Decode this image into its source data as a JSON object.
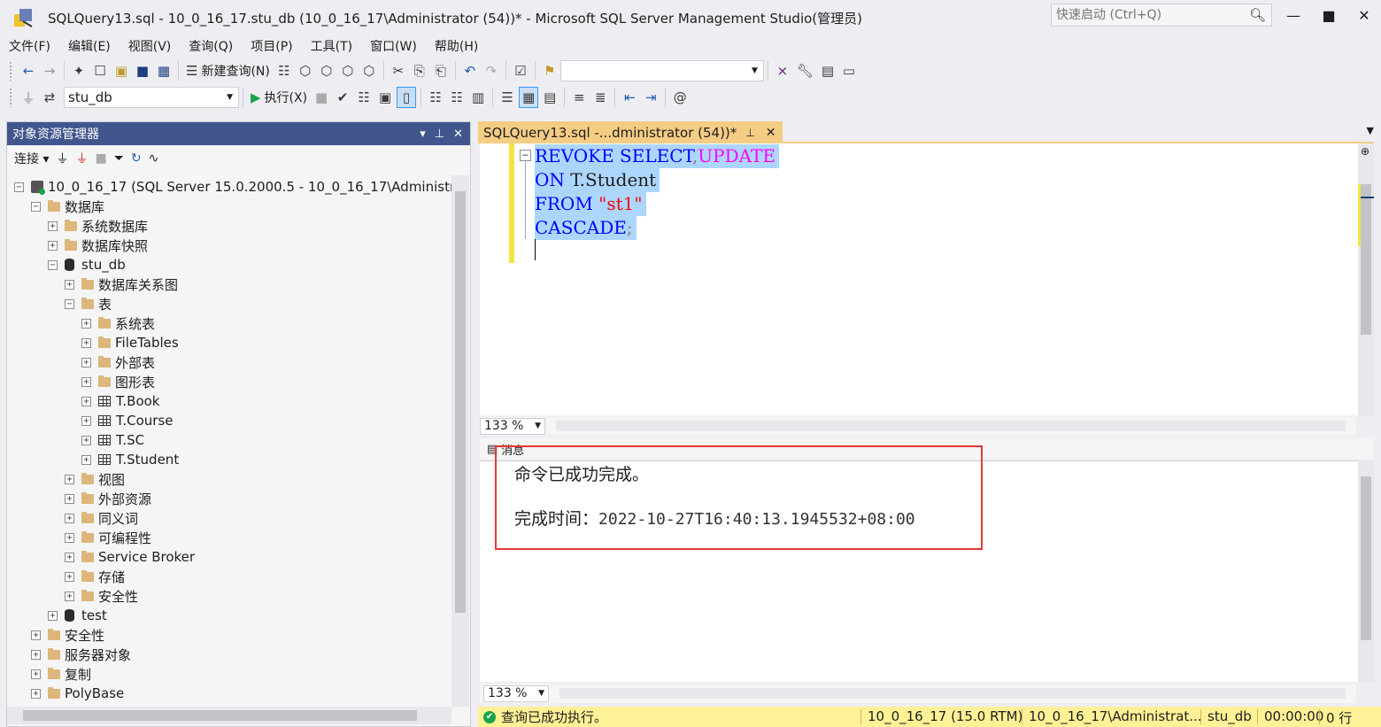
{
  "window": {
    "title": "SQLQuery13.sql - 10_0_16_17.stu_db (10_0_16_17\\Administrator (54))* - Microsoft SQL Server Management Studio(管理员)",
    "quick_launch_placeholder": "快速启动 (Ctrl+Q)"
  },
  "menu": [
    "文件(F)",
    "编辑(E)",
    "视图(V)",
    "查询(Q)",
    "项目(P)",
    "工具(T)",
    "窗口(W)",
    "帮助(H)"
  ],
  "toolbar": {
    "new_query_label": "新建查询(N)",
    "execute_label": "执行(X)",
    "database_selected": "stu_db",
    "solution_config_value": ""
  },
  "object_explorer": {
    "title": "对象资源管理器",
    "connect_label": "连接",
    "tree": {
      "server": "10_0_16_17 (SQL Server 15.0.2000.5 - 10_0_16_17\\Administrato",
      "databases": "数据库",
      "system_databases": "系统数据库",
      "db_snapshots": "数据库快照",
      "stu_db": "stu_db",
      "db_diagrams": "数据库关系图",
      "tables": "表",
      "system_tables": "系统表",
      "file_tables": "FileTables",
      "external_tables": "外部表",
      "graph_tables": "图形表",
      "t_book": "T.Book",
      "t_course": "T.Course",
      "t_sc": "T.SC",
      "t_student": "T.Student",
      "views": "视图",
      "external_resources": "外部资源",
      "synonyms": "同义词",
      "programmability": "可编程性",
      "service_broker": "Service Broker",
      "storage": "存储",
      "db_security": "安全性",
      "test_db": "test",
      "security": "安全性",
      "server_objects": "服务器对象",
      "replication": "复制",
      "polybase": "PolyBase"
    }
  },
  "editor": {
    "tab_label": "SQLQuery13.sql -...dministrator (54))*",
    "code": {
      "l1_kw1": "REVOKE",
      "l1_kw2": "SELECT",
      "l1_comma": ",",
      "l1_kw3": "UPDATE",
      "l2_kw": "ON",
      "l2_obj": "T.Student",
      "l3_kw": "FROM",
      "l3_str": "\"st1\"",
      "l4_kw": "CASCADE",
      "l4_semi": ";"
    },
    "zoom": "133 %"
  },
  "results": {
    "tab_label": "消息",
    "message": "命令已成功完成。",
    "completion_label": "完成时间：",
    "completion_time": "2022-10-27T16:40:13.1945532+08:00",
    "zoom": "133 %"
  },
  "status": {
    "text": "查询已成功执行。",
    "server": "10_0_16_17 (15.0 RTM)",
    "user": "10_0_16_17\\Administrat...",
    "database": "stu_db",
    "elapsed": "00:00:00",
    "rows": "0 行"
  },
  "colors": {
    "status_bar": "#fff196",
    "active_tab": "#f5cc84",
    "oe_title": "#40568d",
    "highlight_box": "#e53935",
    "keyword": "#0000ff",
    "keyword_alt": "#ff00ff",
    "string": "#ff0000"
  }
}
